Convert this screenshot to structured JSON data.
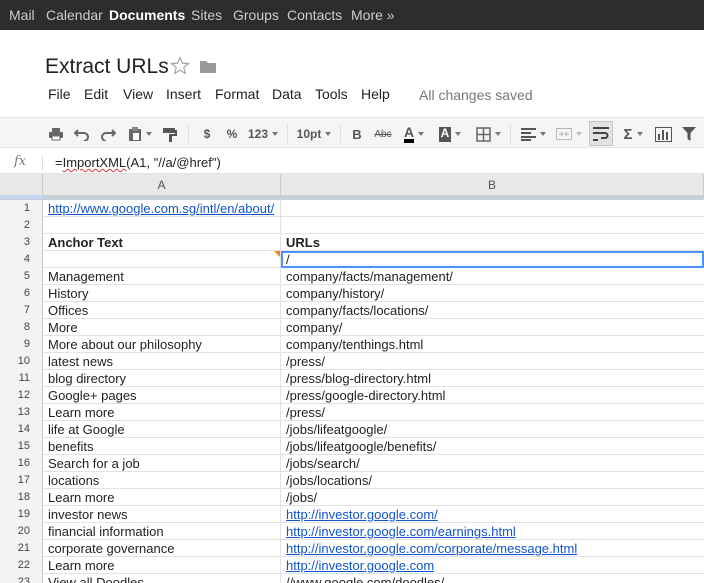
{
  "nav": {
    "items": [
      {
        "label": "Mail",
        "active": false
      },
      {
        "label": "Calendar",
        "active": false
      },
      {
        "label": "Documents",
        "active": true
      },
      {
        "label": "Sites",
        "active": false
      },
      {
        "label": "Groups",
        "active": false
      },
      {
        "label": "Contacts",
        "active": false
      },
      {
        "label": "More »",
        "active": false
      }
    ]
  },
  "document": {
    "title": "Extract URLs",
    "save_status": "All changes saved"
  },
  "menu": {
    "items": [
      "File",
      "Edit",
      "View",
      "Insert",
      "Format",
      "Data",
      "Tools",
      "Help"
    ]
  },
  "toolbar": {
    "currency": "$",
    "percent": "%",
    "number_format": "123",
    "font_size": "10pt",
    "bold": "B",
    "strikethrough": "Abc",
    "text_color": "A",
    "fill_color": "A",
    "sigma": "Σ",
    "text_color_value": "#000000"
  },
  "formula_bar": {
    "fx_label": "fx",
    "formula": "=ImportXML(A1, \"//a/@href\")"
  },
  "columns": [
    "A",
    "B"
  ],
  "rows": [
    {
      "n": "1",
      "a": "http://www.google.com.sg/intl/en/about/",
      "b": "",
      "a_link": true
    },
    {
      "n": "2",
      "a": "",
      "b": ""
    },
    {
      "n": "3",
      "a": "Anchor Text",
      "b": "URLs",
      "bold": true
    },
    {
      "n": "4",
      "a": "",
      "b": "/",
      "selected": true
    },
    {
      "n": "5",
      "a": "Management",
      "b": "company/facts/management/"
    },
    {
      "n": "6",
      "a": "History",
      "b": "company/history/"
    },
    {
      "n": "7",
      "a": "Offices",
      "b": "company/facts/locations/"
    },
    {
      "n": "8",
      "a": "More",
      "b": "company/"
    },
    {
      "n": "9",
      "a": "More about our philosophy",
      "b": "company/tenthings.html"
    },
    {
      "n": "10",
      "a": "latest news",
      "b": "/press/"
    },
    {
      "n": "11",
      "a": "blog directory",
      "b": "/press/blog-directory.html"
    },
    {
      "n": "12",
      "a": "Google+ pages",
      "b": "/press/google-directory.html"
    },
    {
      "n": "13",
      "a": "Learn more",
      "b": "/press/"
    },
    {
      "n": "14",
      "a": "life at Google",
      "b": "/jobs/lifeatgoogle/"
    },
    {
      "n": "15",
      "a": "benefits",
      "b": "/jobs/lifeatgoogle/benefits/"
    },
    {
      "n": "16",
      "a": "Search for a job",
      "b": "/jobs/search/"
    },
    {
      "n": "17",
      "a": "locations",
      "b": "/jobs/locations/"
    },
    {
      "n": "18",
      "a": "Learn more",
      "b": "/jobs/"
    },
    {
      "n": "19",
      "a": "investor news",
      "b": "http://investor.google.com/",
      "b_link": true
    },
    {
      "n": "20",
      "a": "financial information",
      "b": "http://investor.google.com/earnings.html",
      "b_link": true
    },
    {
      "n": "21",
      "a": "corporate governance",
      "b": "http://investor.google.com/corporate/message.html",
      "b_link": true
    },
    {
      "n": "22",
      "a": "Learn more",
      "b": "http://investor.google.com",
      "b_link": true
    },
    {
      "n": "23",
      "a": "View all Doodles",
      "b": "//www.google.com/doodles/"
    }
  ]
}
